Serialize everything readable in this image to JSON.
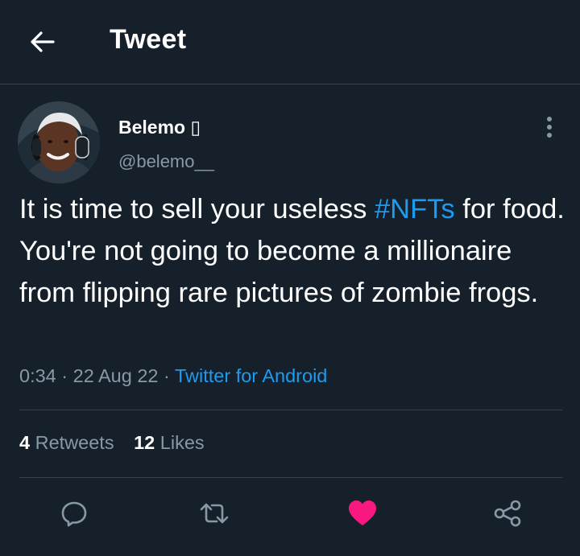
{
  "header": {
    "title": "Tweet",
    "back_icon": "arrow-left-icon"
  },
  "tweet": {
    "author": {
      "name": "Belemo",
      "name_badge": "▯",
      "handle": "@belemo__"
    },
    "text_before": "It is time to sell your useless ",
    "hashtag": "#NFTs",
    "text_after": " for food. You're not going to become a millionaire from flipping rare pictures of zombie frogs.",
    "time": "0:34",
    "separator": " · ",
    "date": "22 Aug 22",
    "source": "Twitter for Android"
  },
  "stats": {
    "retweets_count": "4",
    "retweets_label": "Retweets",
    "likes_count": "12",
    "likes_label": "Likes"
  },
  "actions": {
    "icons": [
      "reply-icon",
      "retweet-icon",
      "heart-icon",
      "share-icon"
    ],
    "liked": true,
    "like_color": "#f91880"
  },
  "colors": {
    "background": "#15202b",
    "accent": "#1d9bf0",
    "secondary_text": "#8899a6",
    "divider": "#38444d"
  }
}
